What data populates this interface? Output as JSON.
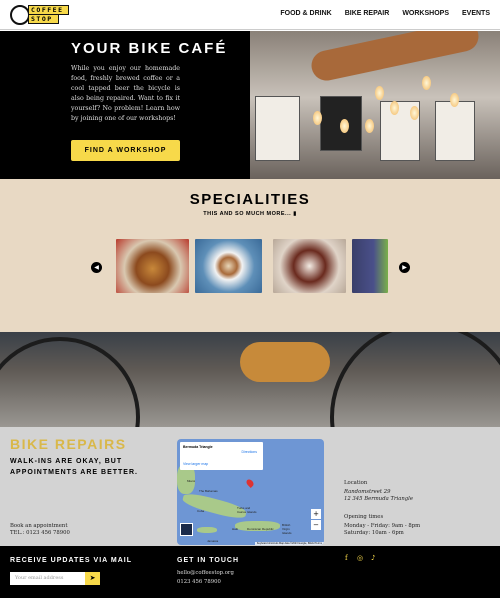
{
  "header": {
    "logo_line1": "COFFEE",
    "logo_line2": "STOP",
    "nav": [
      "FOOD & DRINK",
      "BIKE REPAIR",
      "WORKSHOPS",
      "EVENTS"
    ]
  },
  "hero": {
    "title": "YOUR BIKE CAFÉ",
    "text": "While you enjoy our homemade food, freshly brewed coffee or a cool tapped beer the bicycle is also being repaired. Want to fix it yourself? No problem! Learn how by joining one of our workshops!",
    "button": "FIND A WORKSHOP"
  },
  "specialities": {
    "title": "SPECIALITIES",
    "subtitle": "THIS AND SO MUCH MORE...",
    "prev": "◀",
    "next": "▶"
  },
  "repairs": {
    "title": "BIKE REPAIRS",
    "tagline1": "WALK-INS ARE OKAY, BUT",
    "tagline2": "APPOINTMENTS ARE BETTER.",
    "book": "Book an appointment",
    "tel": "TEL.: 0123 456 78900",
    "map": {
      "place": "Bermuda Triangle",
      "directions": "Directions",
      "larger": "View larger map",
      "labels": [
        "Miami",
        "The Bahamas",
        "Cuba",
        "Turks and Caicos Islands",
        "Haiti",
        "Dominican Republic",
        "Jamaica",
        "British Virgin Islands"
      ],
      "zoom_in": "+",
      "zoom_out": "−",
      "attribution": "Keyboard shortcuts  Map data ©2023 Google, INEGI  Terms"
    },
    "location_label": "Location",
    "address1": "Randomstreet 29",
    "address2": "12 345 Bermuda Triangle",
    "hours_label": "Opening times",
    "hours1": "Monday - Friday: 9am - 8pm",
    "hours2": "Saturday: 10am - 6pm"
  },
  "footer": {
    "mail_title": "RECEIVE UPDATES VIA MAIL",
    "email_placeholder": "Your email address",
    "contact_title": "GET IN TOUCH",
    "email": "hello@coffeestop.org",
    "phone": "0123 456 78900",
    "social": [
      "f",
      "◎",
      "♪"
    ]
  },
  "colors": {
    "accent": "#f7d94a",
    "gold": "#d9b84a",
    "beige": "#e8d9c4",
    "gray": "#d3d3d3"
  }
}
